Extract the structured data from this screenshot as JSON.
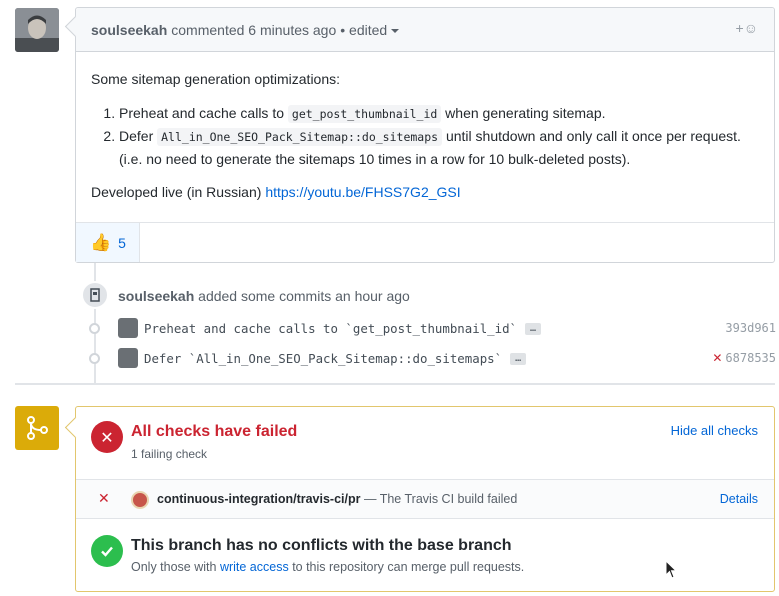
{
  "comment": {
    "author": "soulseekah",
    "meta": "commented 6 minutes ago",
    "edited": "• edited",
    "react_icon": "+☺",
    "intro": "Some sitemap generation optimizations:",
    "items": [
      {
        "prefix": "Preheat and cache calls to ",
        "code": "get_post_thumbnail_id",
        "suffix": " when generating sitemap."
      },
      {
        "prefix": "Defer ",
        "code": "All_in_One_SEO_Pack_Sitemap::do_sitemaps",
        "suffix": " until shutdown and only call it once per request. (i.e. no need to generate the sitemaps 10 times in a row for 10 bulk-deleted posts)."
      }
    ],
    "outro_text": "Developed live (in Russian) ",
    "outro_link": "https://youtu.be/FHSS7G2_GSI",
    "reaction_emoji": "👍",
    "reaction_count": "5"
  },
  "timeline": {
    "author": "soulseekah",
    "action": "added some commits an hour ago",
    "commits": [
      {
        "message": "Preheat and cache calls to `get_post_thumbnail_id`",
        "ellipsis": "…",
        "sha": "393d961",
        "failed": false
      },
      {
        "message": "Defer `All_in_One_SEO_Pack_Sitemap::do_sitemaps`",
        "ellipsis": "…",
        "sha": "6878535",
        "failed": true
      }
    ]
  },
  "merge": {
    "fail_title": "All checks have failed",
    "fail_sub": "1 failing check",
    "hide_checks": "Hide all checks",
    "check_name": "continuous-integration/travis-ci/pr",
    "check_desc": " — The Travis CI build failed",
    "details": "Details",
    "ok_title": "This branch has no conflicts with the base branch",
    "ok_sub_prefix": "Only those with ",
    "ok_sub_link": "write access",
    "ok_sub_suffix": " to this repository can merge pull requests."
  },
  "colors": {
    "link": "#0366d6",
    "fail": "#cb2431",
    "success": "#2cbe4e",
    "warning": "#dbab09"
  }
}
